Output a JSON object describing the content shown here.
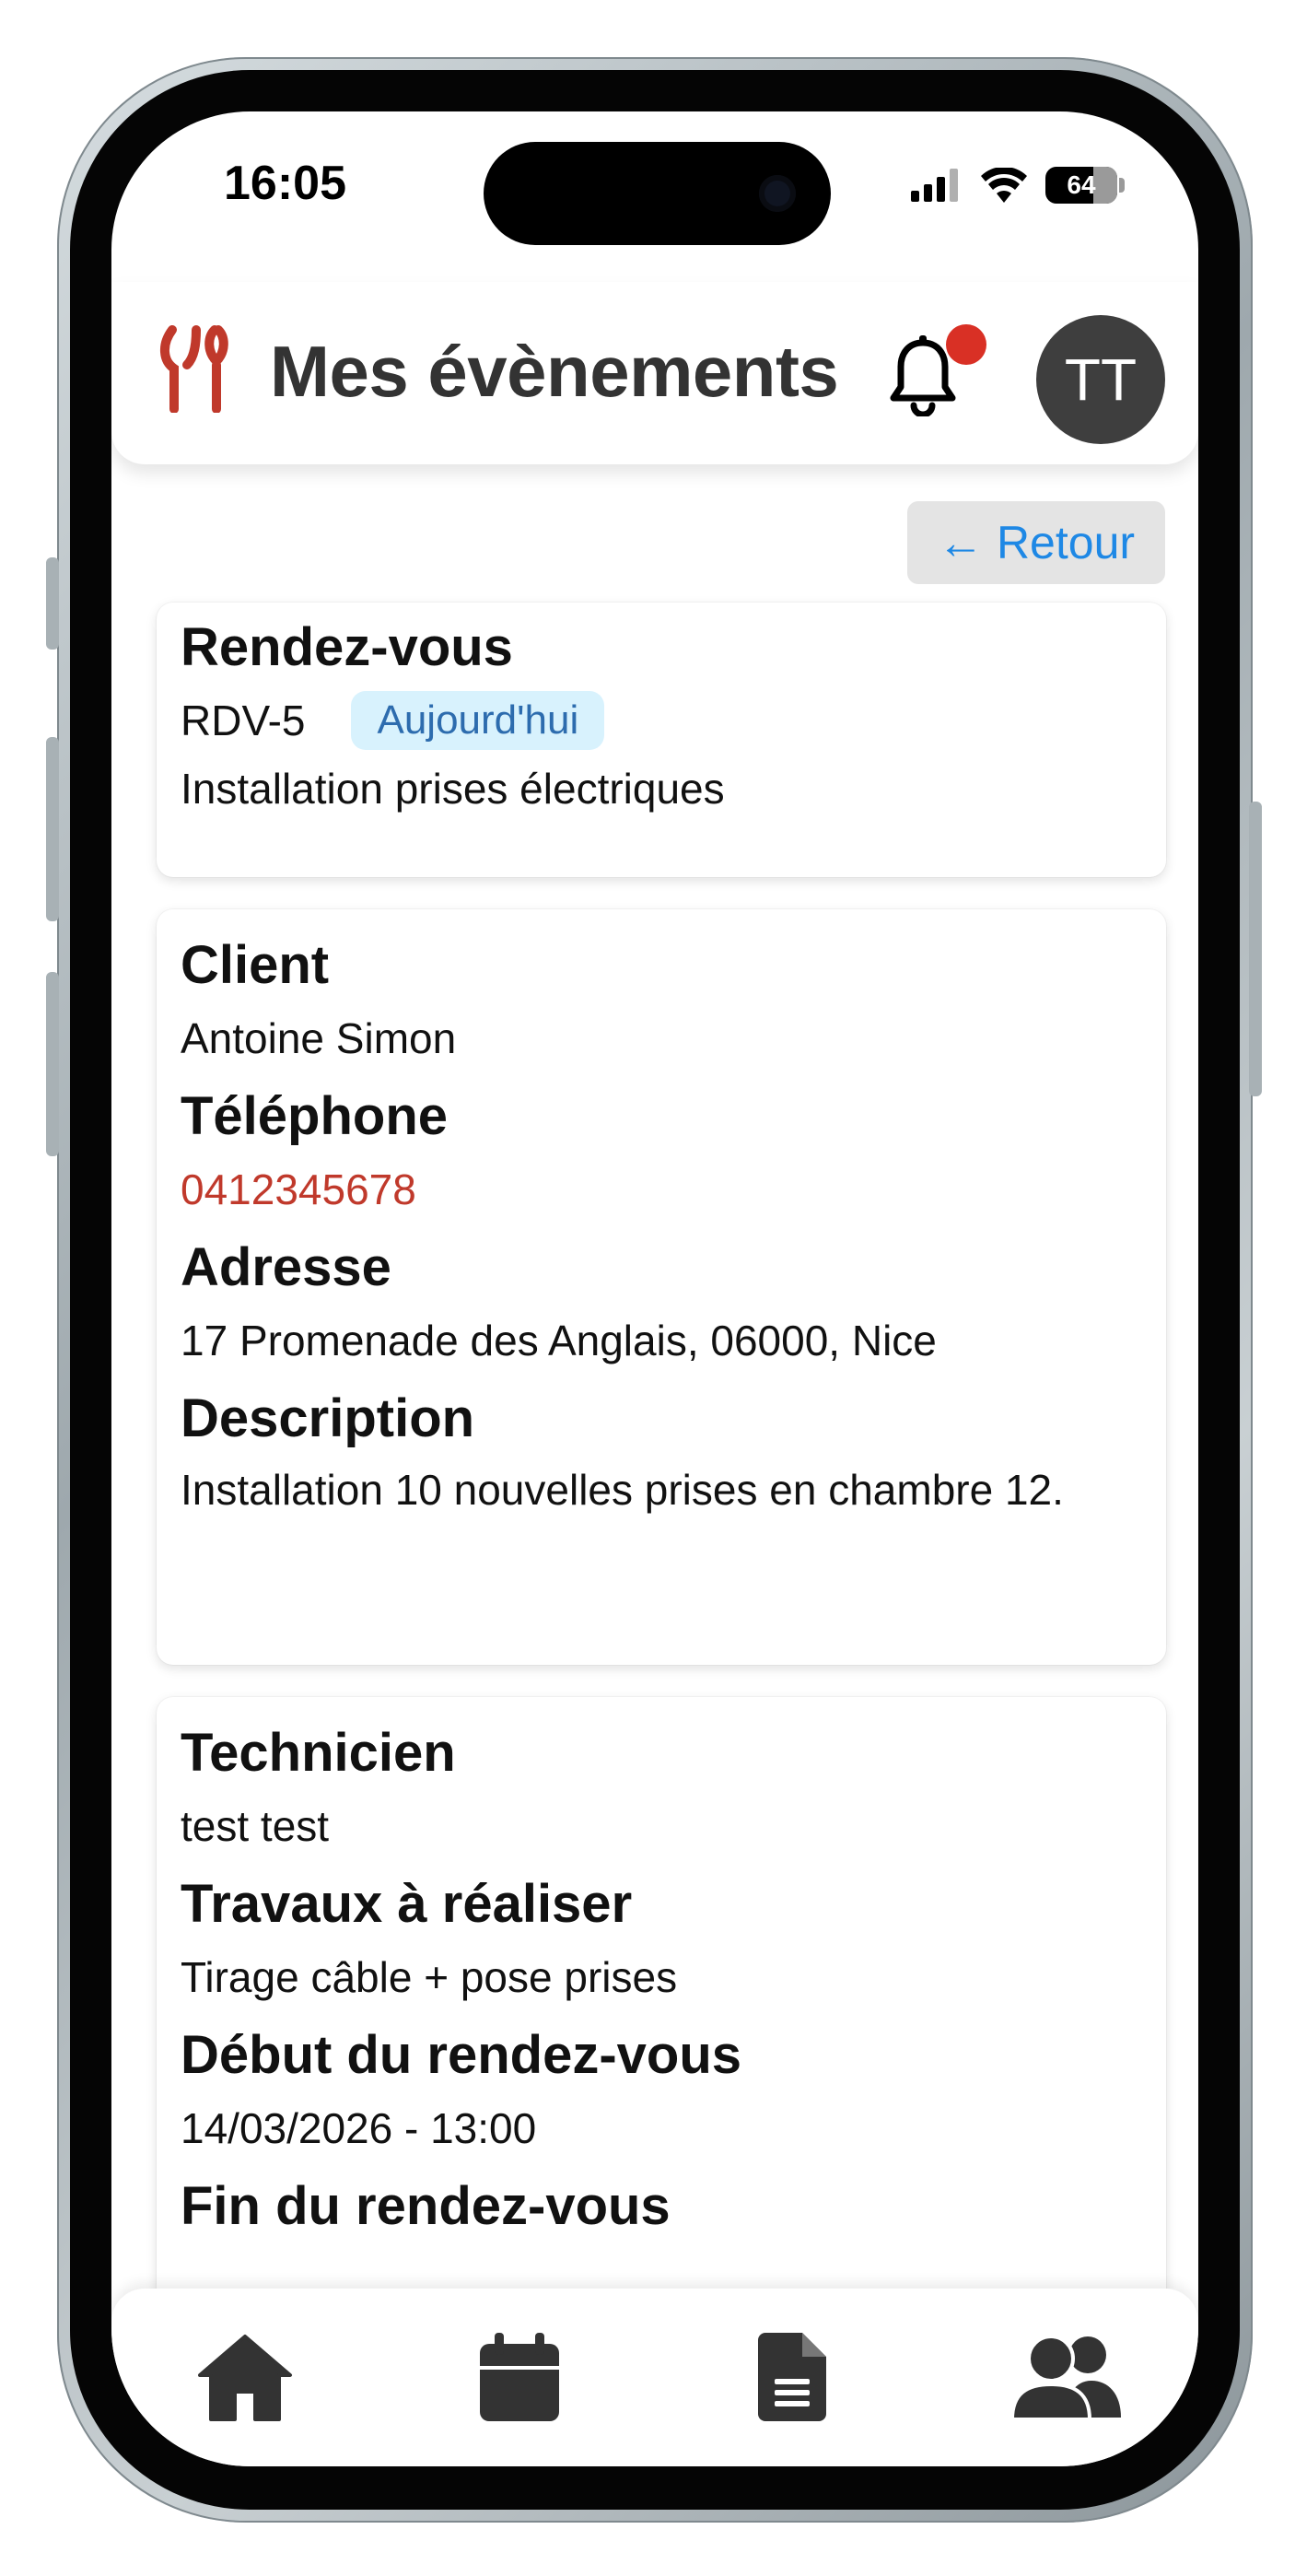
{
  "status_bar": {
    "time": "16:05",
    "battery": "64"
  },
  "header": {
    "title": "Mes évènements",
    "avatar_initials": "TT",
    "accent_color": "#d93025"
  },
  "back_button": {
    "arrow": "←",
    "label": "Retour"
  },
  "appointment_card": {
    "heading": "Rendez-vous",
    "reference": "RDV-5",
    "badge": "Aujourd'hui",
    "title": "Installation prises électriques"
  },
  "client_card": {
    "client_label": "Client",
    "client_value": "Antoine Simon",
    "phone_label": "Téléphone",
    "phone_value": "0412345678",
    "address_label": "Adresse",
    "address_value": "17 Promenade des Anglais, 06000, Nice",
    "description_label": "Description",
    "description_value": "Installation 10 nouvelles prises en chambre 12."
  },
  "tech_card": {
    "technician_label": "Technicien",
    "technician_value": "test test",
    "work_label": "Travaux à réaliser",
    "work_value": "Tirage câble + pose prises",
    "start_label": "Début du rendez-vous",
    "start_value": "14/03/2026 - 13:00",
    "end_label": "Fin du rendez-vous"
  },
  "bottom_nav": {
    "items": [
      "home-icon",
      "calendar-icon",
      "document-icon",
      "users-icon"
    ]
  }
}
